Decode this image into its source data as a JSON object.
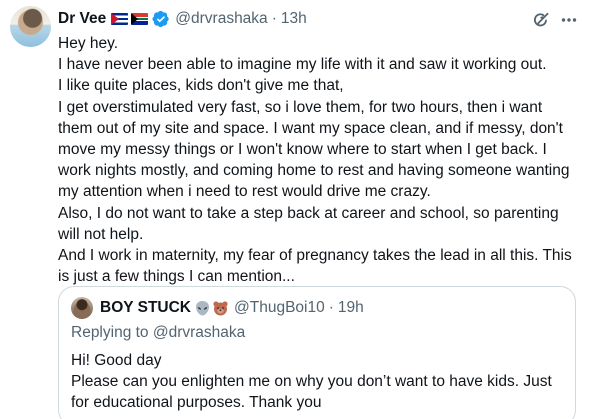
{
  "tweet": {
    "author": {
      "display_name": "Dr Vee",
      "flags": [
        "cuba-flag",
        "south-africa-flag"
      ],
      "verified": true,
      "handle": "@drvrashaka"
    },
    "separator": "·",
    "time": "13h",
    "body": [
      "Hey hey.",
      "I have never been able to imagine my life with it and saw it working out.",
      "I like quite places, kids don't give me that,",
      "I get overstimulated very fast, so i love them, for two hours, then i want",
      "them out of my site and space. I want my space clean, and if messy, don't",
      "move my messy things or I won't know where to start when I get back. I",
      "work nights mostly, and coming home to rest and having someone wanting",
      "my attention when i need to rest would drive me crazy.",
      "Also, I do not want to take a step back at career and school, so parenting",
      "will not help.",
      "And I work in maternity, my fear of pregnancy takes the lead in all this. This",
      "is just a few things I can mention..."
    ],
    "icons": {
      "grok": "grok-icon",
      "more": "more-icon"
    },
    "colors": {
      "text": "#0f1419",
      "secondary": "#536471",
      "verified": "#1d9bf0",
      "border": "#cfd9de"
    }
  },
  "quote": {
    "author": {
      "display_name": "BOY STUCK",
      "emoji": [
        "alien-emoji",
        "bear-emoji"
      ],
      "handle": "@ThugBoi10"
    },
    "separator": "·",
    "time": "19h",
    "replying_prefix": "Replying to ",
    "replying_to": "@drvrashaka",
    "body": [
      "Hi! Good day",
      "Please can you enlighten me on why you don’t want to have kids. Just",
      "for educational purposes. Thank you"
    ]
  }
}
